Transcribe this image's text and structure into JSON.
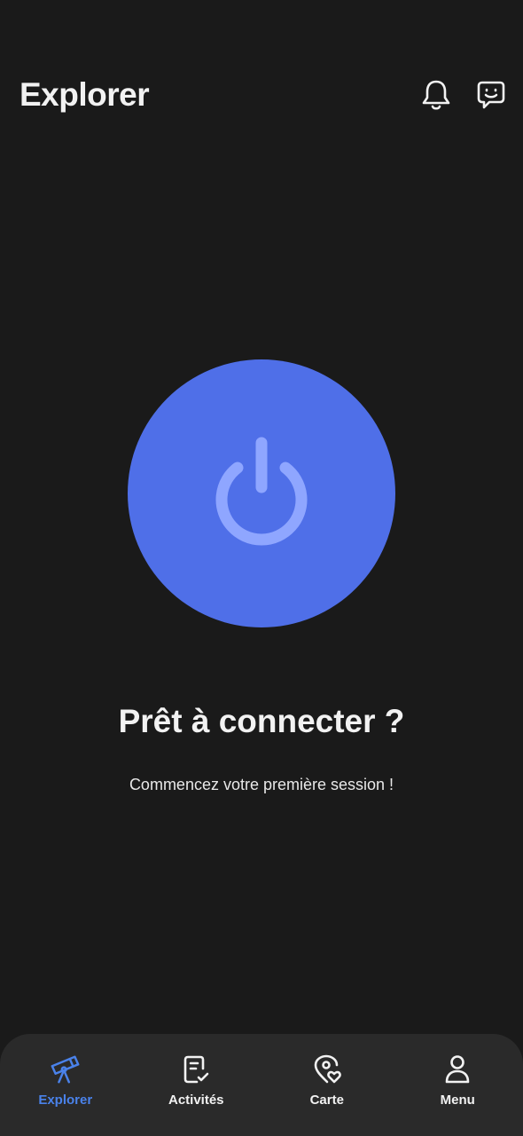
{
  "header": {
    "title": "Explorer",
    "notifications_icon": "bell-icon",
    "chat_icon": "chat-smile-icon"
  },
  "main": {
    "power_icon": "power-icon",
    "headline": "Prêt à connecter ?",
    "subline": "Commencez votre première session !"
  },
  "tabs": [
    {
      "label": "Explorer",
      "icon": "telescope-icon",
      "active": true
    },
    {
      "label": "Activités",
      "icon": "checklist-icon",
      "active": false
    },
    {
      "label": "Carte",
      "icon": "map-pin-heart-icon",
      "active": false
    },
    {
      "label": "Menu",
      "icon": "person-icon",
      "active": false
    }
  ],
  "colors": {
    "background": "#1a1a1a",
    "tabbar": "#2a2a2a",
    "accent": "#4f6fe8",
    "accent_light": "#8fa6ff",
    "active_tab": "#4a82ea",
    "text": "#f2f2f2"
  }
}
